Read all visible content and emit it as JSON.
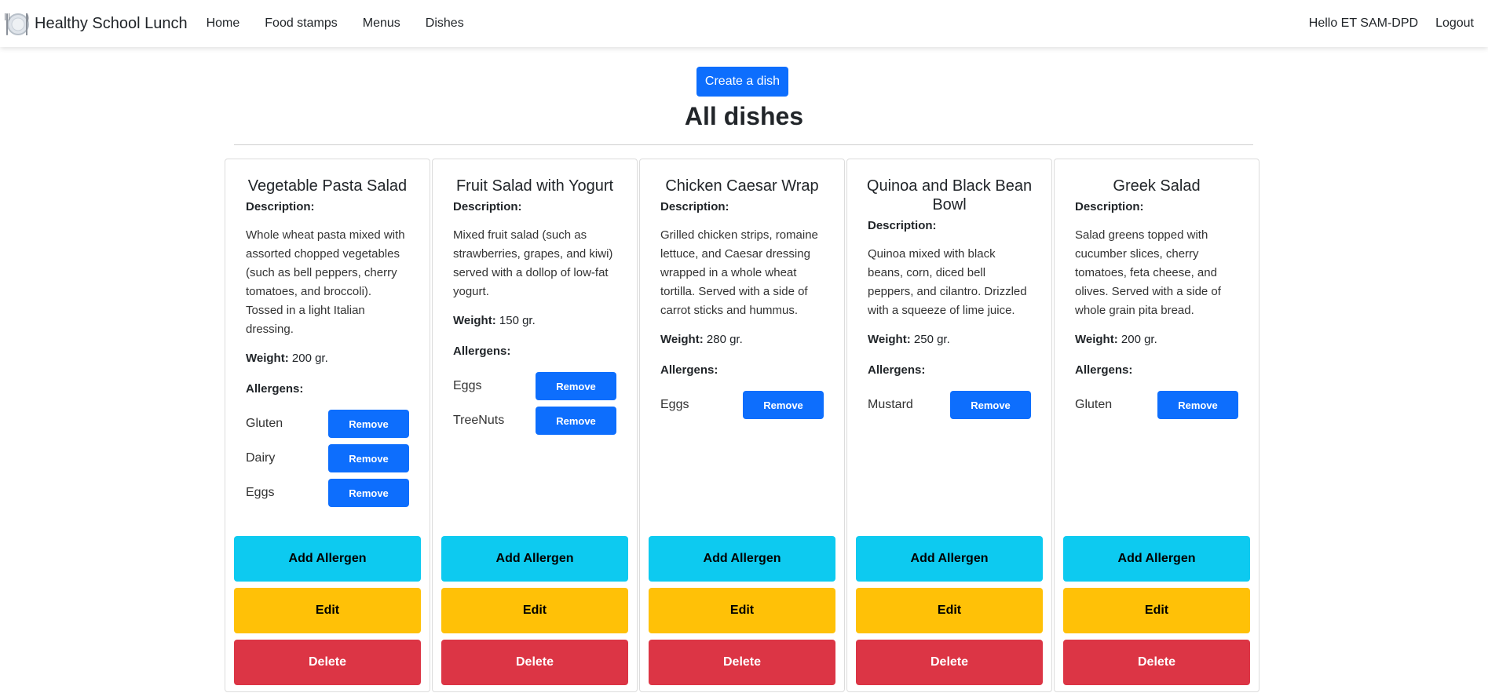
{
  "nav": {
    "brand": "Healthy School Lunch",
    "links": [
      "Home",
      "Food stamps",
      "Menus",
      "Dishes"
    ],
    "hello": "Hello ET SAM-DPD",
    "logout": "Logout"
  },
  "header": {
    "create_label": "Create a dish",
    "title": "All dishes"
  },
  "labels": {
    "description": "Description:",
    "weight": "Weight:",
    "allergens": "Allergens:",
    "remove": "Remove",
    "add_allergen": "Add Allergen",
    "edit": "Edit",
    "delete": "Delete"
  },
  "dishes": [
    {
      "name": "Vegetable Pasta Salad",
      "description": "Whole wheat pasta mixed with assorted chopped vegetables (such as bell peppers, cherry tomatoes, and broccoli). Tossed in a light Italian dressing.",
      "weight": "200 gr.",
      "allergens": [
        "Gluten",
        "Dairy",
        "Eggs"
      ]
    },
    {
      "name": "Fruit Salad with Yogurt",
      "description": "Mixed fruit salad (such as strawberries, grapes, and kiwi) served with a dollop of low-fat yogurt.",
      "weight": "150 gr.",
      "allergens": [
        "Eggs",
        "TreeNuts"
      ]
    },
    {
      "name": "Chicken Caesar Wrap",
      "description": "Grilled chicken strips, romaine lettuce, and Caesar dressing wrapped in a whole wheat tortilla. Served with a side of carrot sticks and hummus.",
      "weight": "280 gr.",
      "allergens": [
        "Eggs"
      ]
    },
    {
      "name": "Quinoa and Black Bean Bowl",
      "description": "Quinoa mixed with black beans, corn, diced bell peppers, and cilantro. Drizzled with a squeeze of lime juice.",
      "weight": "250 gr.",
      "allergens": [
        "Mustard"
      ]
    },
    {
      "name": "Greek Salad",
      "description": "Salad greens topped with cucumber slices, cherry tomatoes, feta cheese, and olives. Served with a side of whole grain pita bread.",
      "weight": "200 gr.",
      "allergens": [
        "Gluten"
      ]
    }
  ],
  "colors": {
    "primary": "#0d6efd",
    "info": "#0dcaf0",
    "warning": "#ffc107",
    "danger": "#dc3545"
  }
}
